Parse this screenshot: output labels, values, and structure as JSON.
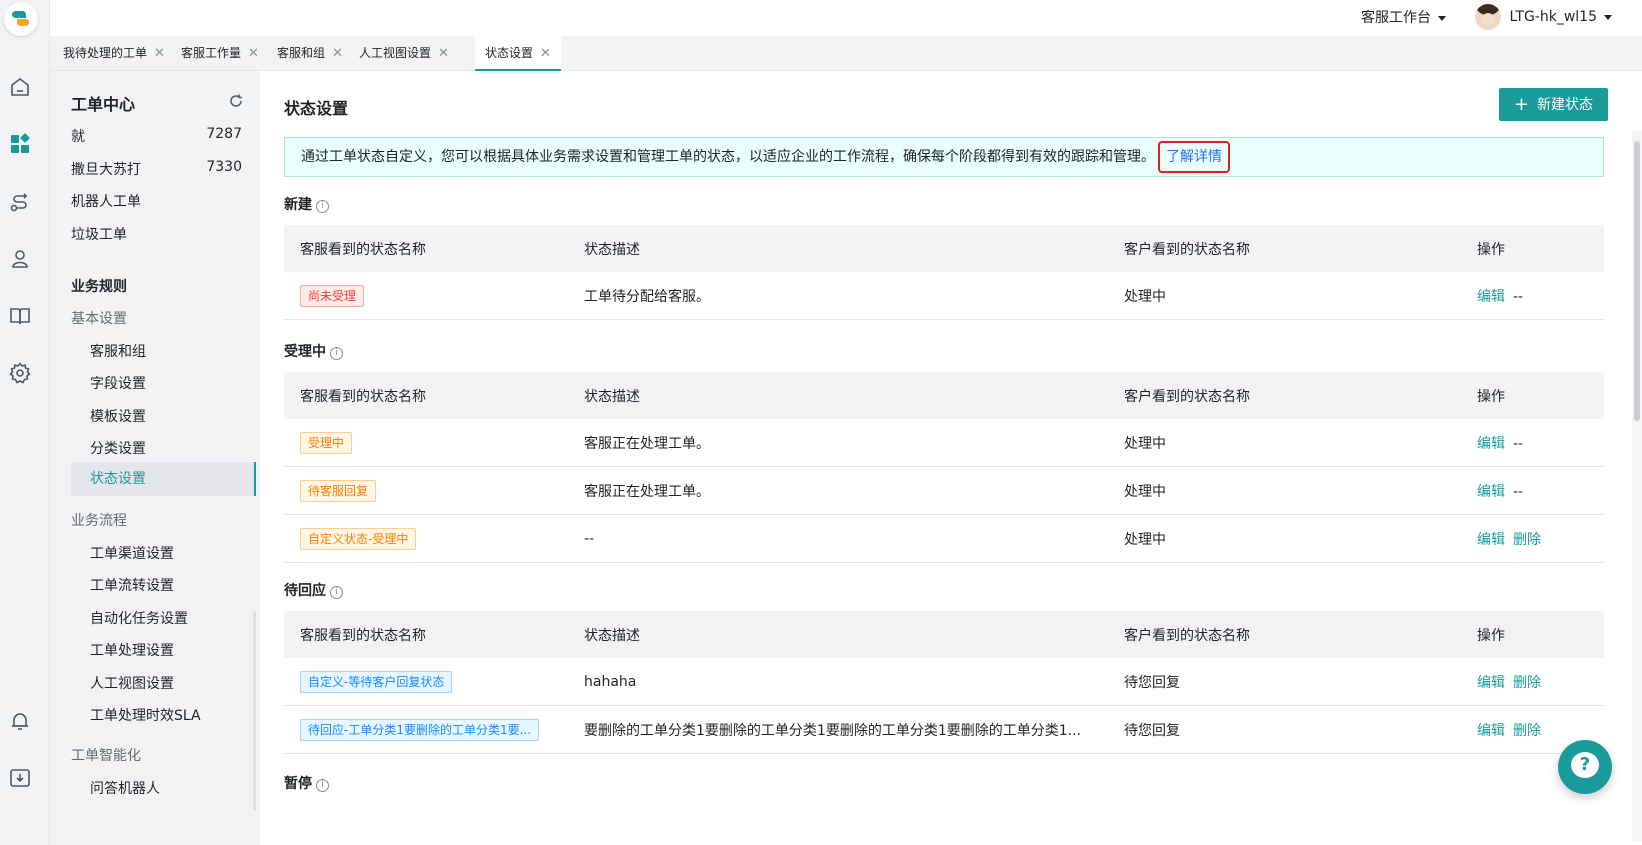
{
  "topbar": {
    "workspace": "客服工作台",
    "user": "LTG-hk_wl15"
  },
  "tabs": [
    {
      "label": "我待处理的工单"
    },
    {
      "label": "客服工作量"
    },
    {
      "label": "客服和组"
    },
    {
      "label": "人工视图设置"
    },
    {
      "label": "状态设置"
    }
  ],
  "nav": {
    "title": "工单中心",
    "items": [
      {
        "label": "就",
        "count": "7287"
      },
      {
        "label": "撒旦大苏打",
        "count": "7330"
      },
      {
        "label": "机器人工单"
      },
      {
        "label": "垃圾工单"
      }
    ],
    "business_rules": "业务规则",
    "basic_settings": "基本设置",
    "basic_items": [
      "客服和组",
      "字段设置",
      "模板设置",
      "分类设置",
      "状态设置"
    ],
    "business_flow": "业务流程",
    "flow_items": [
      "工单渠道设置",
      "工单流转设置",
      "自动化任务设置",
      "工单处理设置",
      "人工视图设置",
      "工单处理时效SLA"
    ],
    "intelligence": "工单智能化",
    "intel_items": [
      "问答机器人"
    ]
  },
  "main": {
    "title": "状态设置",
    "new_button": "新建状态",
    "banner_text": "通过工单状态自定义，您可以根据具体业务需求设置和管理工单的状态，以适应企业的工作流程，确保每个阶段都得到有效的跟踪和管理。",
    "banner_link": "了解详情",
    "columns": [
      "客服看到的状态名称",
      "状态描述",
      "客户看到的状态名称",
      "操作"
    ],
    "actions": {
      "edit": "编辑",
      "delete": "删除",
      "none": "--"
    },
    "sections": [
      {
        "name": "新建",
        "rows": [
          {
            "tag": "尚未受理",
            "desc": "工单待分配给客服。",
            "customer": "处理中",
            "deletable": false
          }
        ]
      },
      {
        "name": "受理中",
        "rows": [
          {
            "tag": "受理中",
            "desc": "客服正在处理工单。",
            "customer": "处理中",
            "deletable": false
          },
          {
            "tag": "待客服回复",
            "desc": "客服正在处理工单。",
            "customer": "处理中",
            "deletable": false
          },
          {
            "tag": "自定义状态-受理中",
            "desc": "--",
            "customer": "处理中",
            "deletable": true
          }
        ]
      },
      {
        "name": "待回应",
        "rows": [
          {
            "tag": "自定义-等待客户回复状态",
            "desc": "hahaha",
            "customer": "待您回复",
            "deletable": true
          },
          {
            "tag": "待回应-工单分类1要删除的工单分类1要...",
            "desc": "要删除的工单分类1要删除的工单分类1要删除的工单分类1要删除的工单分类1...",
            "customer": "待您回复",
            "deletable": true
          }
        ]
      },
      {
        "name": "暂停",
        "rows": []
      }
    ]
  },
  "colors": {
    "accent": "#1a9b9b",
    "tag_red": "#f53f3f",
    "tag_orange": "#ff7d00",
    "tag_blue": "#168cff"
  }
}
